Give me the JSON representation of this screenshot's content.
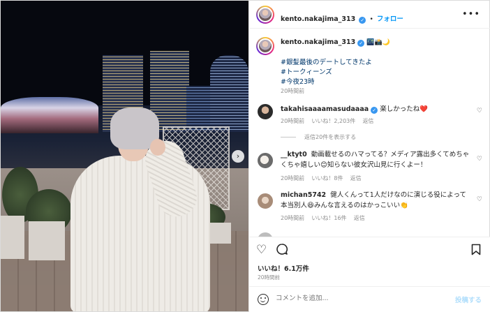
{
  "post": {
    "username": "kento.nakajima_313",
    "follow_label": "フォロー",
    "separator": "•",
    "more_label": "•••",
    "caption_emoji": "🌃📸🌙",
    "caption_lines": [
      "#銀髪最後のデートしてきたよ",
      "#トークィーンズ",
      "#今夜23時"
    ],
    "caption_time": "20時間前",
    "next_label": "›"
  },
  "comments": [
    {
      "username": "takahisaaaamasudaaaa",
      "verified": true,
      "text": "楽しかったね❤️",
      "time": "20時間前",
      "likes": "いいね！2,203件",
      "reply": "返信"
    },
    {
      "username": "__ktyt0",
      "verified": false,
      "text": "動画載せるのハマってる？メディア露出多くてめちゃくちゃ嬉しい😊知らない彼女沢山見に行くよー！",
      "time": "20時間前",
      "likes": "いいね！8件",
      "reply": "返信"
    },
    {
      "username": "michan5742",
      "verified": false,
      "text": "健人くんって1人だけなのに演じる役によって本当別人😆みんな言えるのはかっこいい👏",
      "time": "20時間前",
      "likes": "いいね！16件",
      "reply": "返信"
    }
  ],
  "view_replies": "返信20件を表示する",
  "actions": {
    "likes": "いいね！6.1万件",
    "time": "20時間前",
    "comment_placeholder": "コメントを追加...",
    "post_label": "投稿する"
  },
  "icons": {
    "heart": "♡",
    "comment": "◯",
    "bookmark": "⌑"
  },
  "colors": {
    "link_blue": "#0095f6",
    "hashtag": "#00376b",
    "meta_gray": "#8e8e8e",
    "verified": "#3897f0"
  }
}
